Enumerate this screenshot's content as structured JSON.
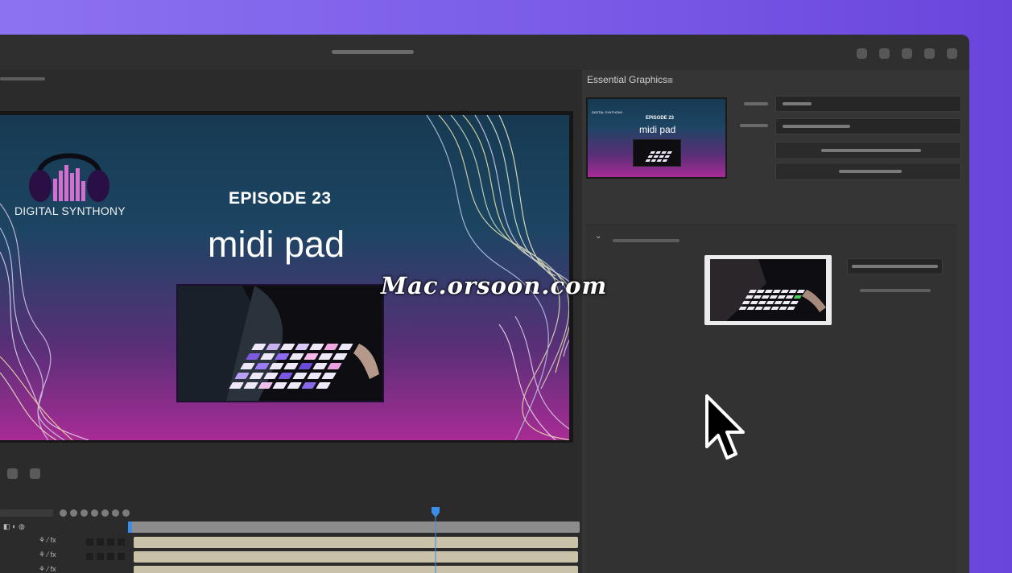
{
  "panel": {
    "title": "Essential Graphics",
    "menu_icon": "≡"
  },
  "program_monitor": {
    "logo_text": "DIGITAL SYNTHONY",
    "episode": "EPISODE 23",
    "title": "midi pad"
  },
  "template_thumbnail": {
    "logo_text": "DIGITAL SYNTHONY",
    "episode": "EPISODE 23",
    "title": "midi pad"
  },
  "watermark": "Mac.orsoon.com",
  "section": {
    "chevron": "⌄"
  },
  "timeline": {
    "fx_label": "fx"
  },
  "colors": {
    "background": "#7a5ce8",
    "panel": "#353535",
    "playhead": "#3b8ee8",
    "track": "#c9c1a8"
  }
}
